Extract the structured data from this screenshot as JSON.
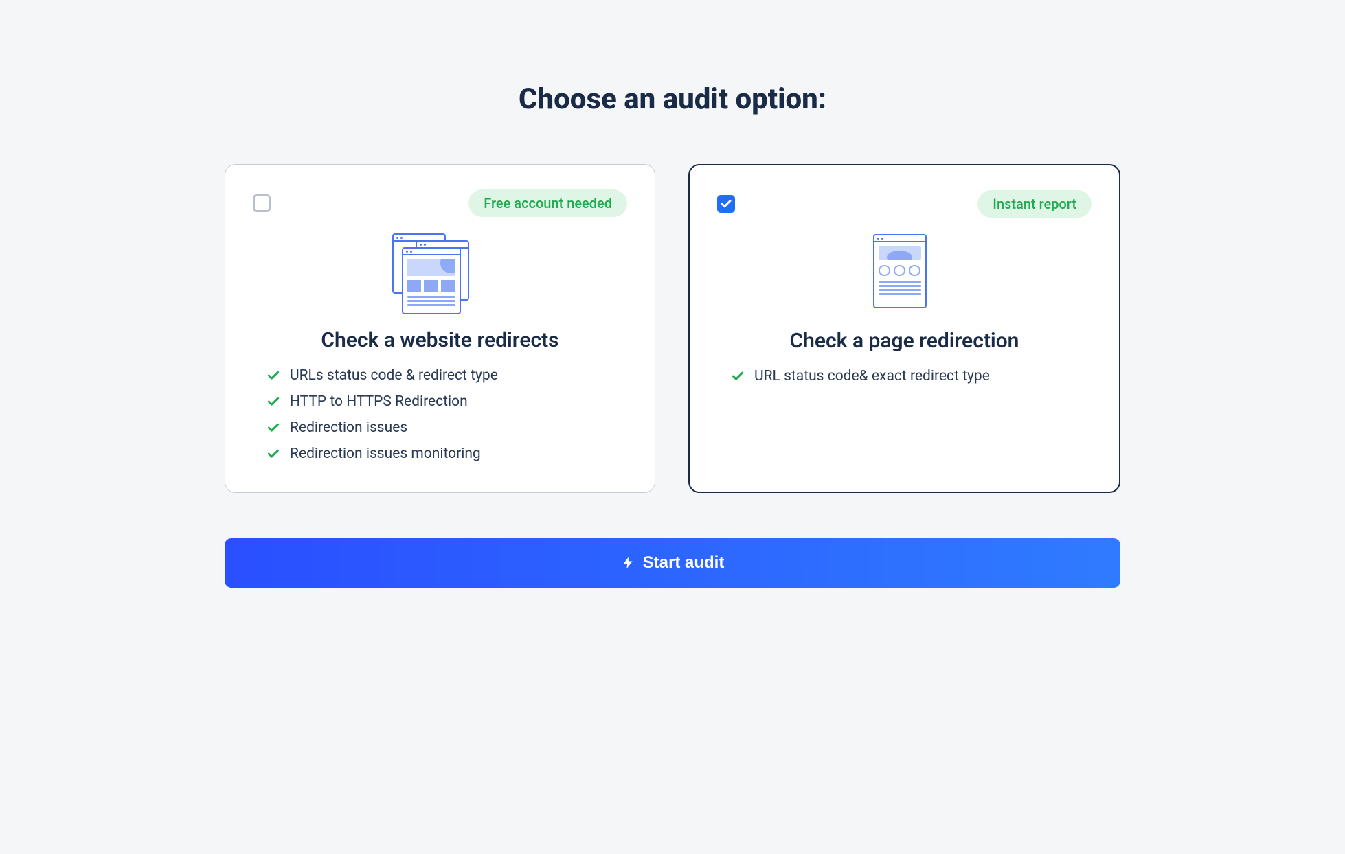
{
  "title": "Choose an audit option:",
  "cards": [
    {
      "selected": false,
      "badge": "Free account needed",
      "title": "Check a website redirects",
      "features": [
        "URLs status code & redirect type",
        "HTTP to HTTPS Redirection",
        "Redirection issues",
        "Redirection issues monitoring"
      ]
    },
    {
      "selected": true,
      "badge": "Instant report",
      "title": "Check a page redirection",
      "features": [
        "URL status code& exact redirect type"
      ]
    }
  ],
  "cta": "Start audit"
}
